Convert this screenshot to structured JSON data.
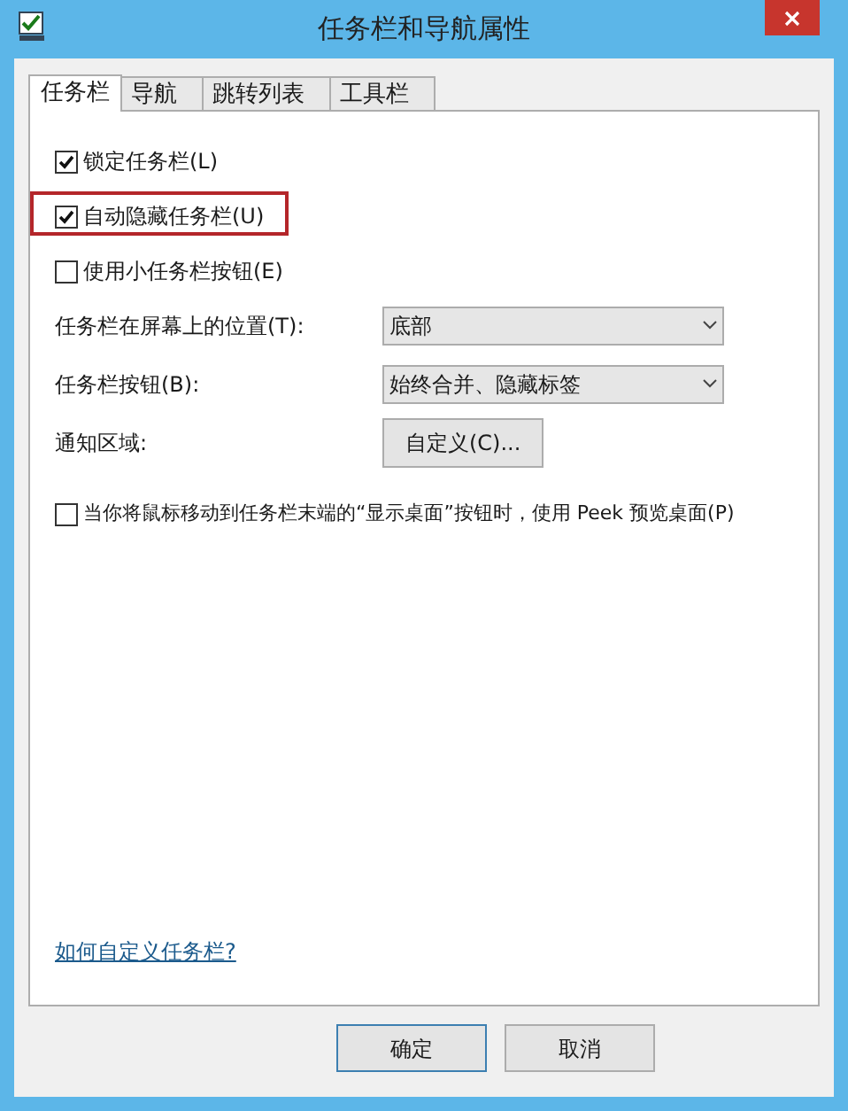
{
  "window": {
    "title": "任务栏和导航属性"
  },
  "tabs": [
    {
      "label": "任务栏",
      "selected": true
    },
    {
      "label": "导航",
      "selected": false
    },
    {
      "label": "跳转列表",
      "selected": false
    },
    {
      "label": "工具栏",
      "selected": false
    }
  ],
  "options": [
    {
      "label": "锁定任务栏(L)",
      "checked": true,
      "highlighted": false
    },
    {
      "label": "自动隐藏任务栏(U)",
      "checked": true,
      "highlighted": true
    },
    {
      "label": "使用小任务栏按钮(E)",
      "checked": false,
      "highlighted": false
    }
  ],
  "settings": [
    {
      "kind": "dropdown",
      "label": "任务栏在屏幕上的位置(T):",
      "value": "底部"
    },
    {
      "kind": "dropdown",
      "label": "任务栏按钮(B):",
      "value": "始终合并、隐藏标签"
    },
    {
      "kind": "button",
      "label": "通知区域:",
      "value": "自定义(C)..."
    }
  ],
  "peek": {
    "label": "当你将鼠标移动到任务栏末端的“显示桌面”按钮时，使用 Peek 预览桌面(P)",
    "checked": false
  },
  "help_link": "如何自定义任务栏?",
  "buttons": [
    "确定",
    "取消"
  ]
}
